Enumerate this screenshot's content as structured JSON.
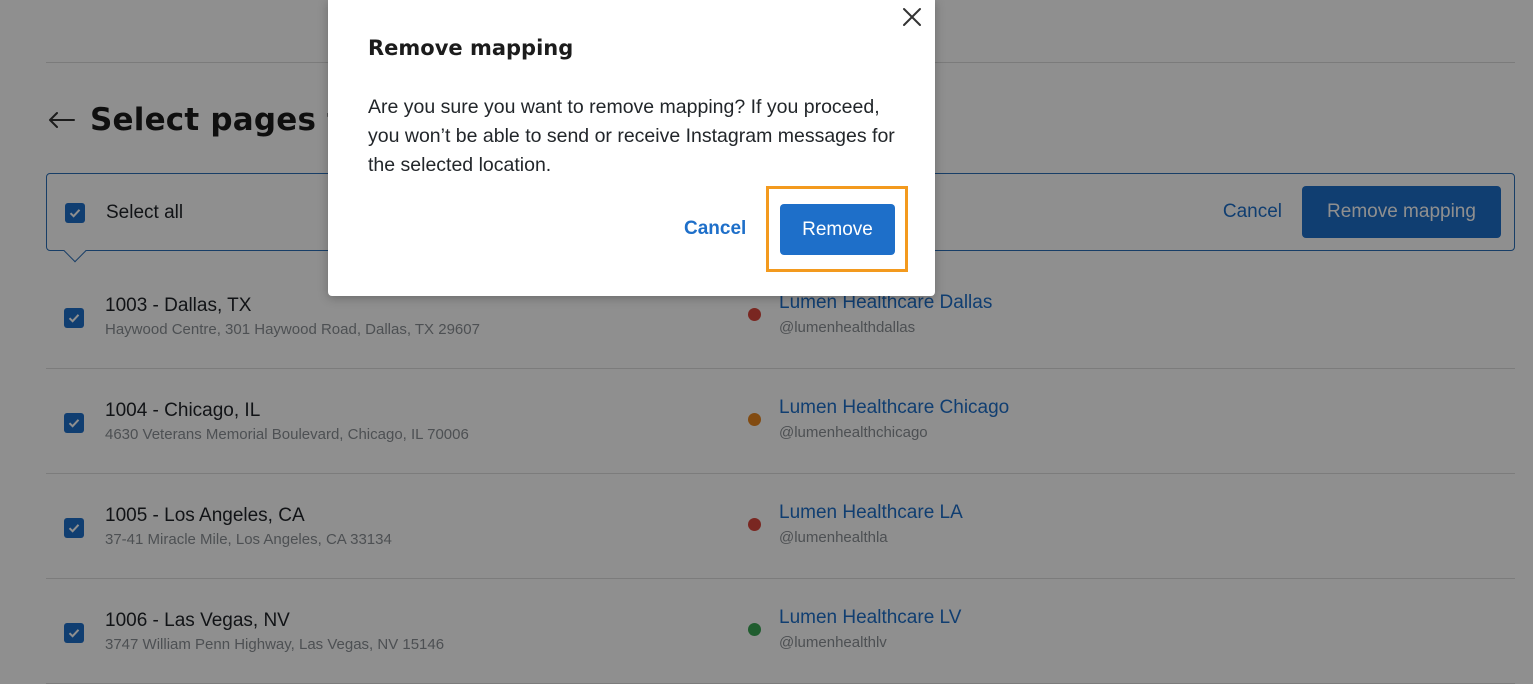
{
  "page": {
    "title": "Select pages to remove mapping",
    "select_all_label": "Select all",
    "cancel_label": "Cancel",
    "remove_mapping_label": "Remove mapping",
    "rows": [
      {
        "location": "1003 - Dallas, TX",
        "address": "Haywood Centre, 301 Haywood Road, Dallas, TX 29607",
        "account": "Lumen Healthcare Dallas",
        "handle": "@lumenhealthdallas",
        "status_color": "#d9473b"
      },
      {
        "location": "1004 - Chicago, IL",
        "address": "4630 Veterans Memorial Boulevard, Chicago, IL 70006",
        "account": "Lumen Healthcare Chicago",
        "handle": "@lumenhealthchicago",
        "status_color": "#e8861f"
      },
      {
        "location": "1005 - Los Angeles, CA",
        "address": "37-41 Miracle Mile, Los Angeles, CA 33134",
        "account": "Lumen Healthcare LA",
        "handle": "@lumenhealthla",
        "status_color": "#d9473b"
      },
      {
        "location": "1006 - Las Vegas, NV",
        "address": "3747 William Penn Highway, Las Vegas, NV 15146",
        "account": "Lumen Healthcare LV",
        "handle": "@lumenhealthlv",
        "status_color": "#3aa655"
      }
    ]
  },
  "modal": {
    "title": "Remove mapping",
    "body": "Are you sure you want to remove mapping? If you proceed, you won’t be able to send or receive Instagram messages for the selected location.",
    "cancel_label": "Cancel",
    "remove_label": "Remove"
  },
  "icons": {
    "close": "close-icon",
    "back": "back-arrow-icon",
    "checkbox": "checkbox-checked-icon"
  },
  "colors": {
    "accent": "#1e6fc9",
    "highlight": "#f39a1e"
  }
}
